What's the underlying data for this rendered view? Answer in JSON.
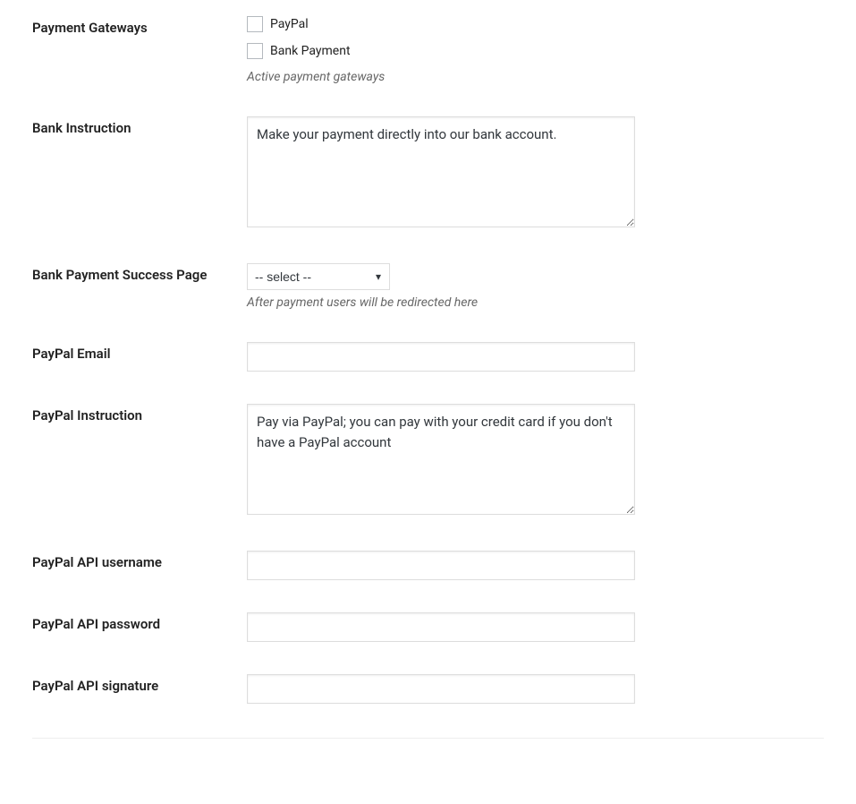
{
  "fields": {
    "payment_gateways": {
      "label": "Payment Gateways",
      "options": {
        "paypal": "PayPal",
        "bank": "Bank Payment"
      },
      "description": "Active payment gateways"
    },
    "bank_instruction": {
      "label": "Bank Instruction",
      "value": "Make your payment directly into our bank account."
    },
    "bank_success_page": {
      "label": "Bank Payment Success Page",
      "selected": "-- select --",
      "description": "After payment users will be redirected here"
    },
    "paypal_email": {
      "label": "PayPal Email",
      "value": ""
    },
    "paypal_instruction": {
      "label": "PayPal Instruction",
      "value": "Pay via PayPal; you can pay with your credit card if you don't have a PayPal account"
    },
    "paypal_api_username": {
      "label": "PayPal API username",
      "value": ""
    },
    "paypal_api_password": {
      "label": "PayPal API password",
      "value": ""
    },
    "paypal_api_signature": {
      "label": "PayPal API signature",
      "value": ""
    }
  }
}
